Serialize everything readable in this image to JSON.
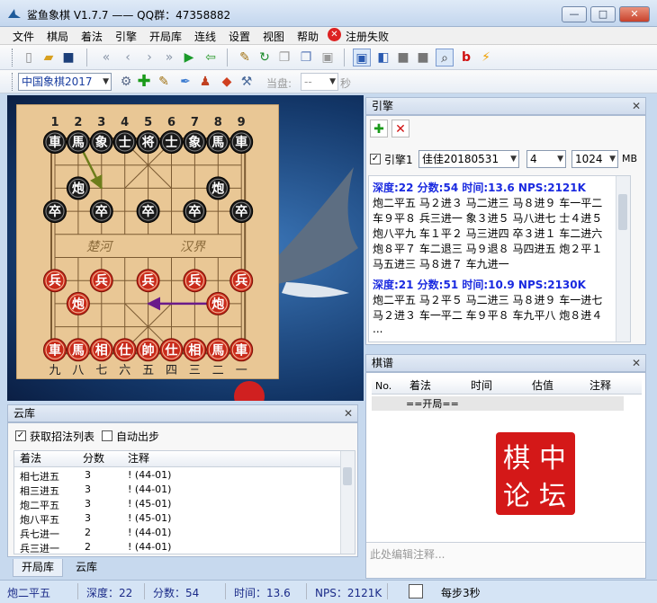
{
  "window": {
    "title": "鲨鱼象棋 V1.7.7  —— QQ群：47358882",
    "controls": {
      "minimize": "—",
      "maximize": "□",
      "close": "✕"
    }
  },
  "menu": [
    "文件",
    "棋局",
    "着法",
    "引擎",
    "开局库",
    "连线",
    "设置",
    "视图",
    "帮助"
  ],
  "menu_register": "注册失败",
  "toolbar2": {
    "engine_select": "中国象棋2017",
    "current_label": "当盘:",
    "current_value": "--",
    "seconds_label": "秒"
  },
  "board": {
    "top_numbers": [
      "1",
      "2",
      "3",
      "4",
      "5",
      "6",
      "7",
      "8",
      "9"
    ],
    "bottom_numbers": [
      "九",
      "八",
      "七",
      "六",
      "五",
      "四",
      "三",
      "二",
      "一"
    ],
    "river_left": "楚河",
    "river_right": "汉界",
    "black_pieces": [
      {
        "c": 0,
        "r": 0,
        "t": "車"
      },
      {
        "c": 1,
        "r": 0,
        "t": "馬"
      },
      {
        "c": 2,
        "r": 0,
        "t": "象"
      },
      {
        "c": 3,
        "r": 0,
        "t": "士"
      },
      {
        "c": 4,
        "r": 0,
        "t": "将"
      },
      {
        "c": 5,
        "r": 0,
        "t": "士"
      },
      {
        "c": 6,
        "r": 0,
        "t": "象"
      },
      {
        "c": 7,
        "r": 0,
        "t": "馬"
      },
      {
        "c": 8,
        "r": 0,
        "t": "車"
      },
      {
        "c": 1,
        "r": 2,
        "t": "炮"
      },
      {
        "c": 7,
        "r": 2,
        "t": "炮"
      },
      {
        "c": 0,
        "r": 3,
        "t": "卒"
      },
      {
        "c": 2,
        "r": 3,
        "t": "卒"
      },
      {
        "c": 4,
        "r": 3,
        "t": "卒"
      },
      {
        "c": 6,
        "r": 3,
        "t": "卒"
      },
      {
        "c": 8,
        "r": 3,
        "t": "卒"
      }
    ],
    "red_pieces": [
      {
        "c": 0,
        "r": 6,
        "t": "兵"
      },
      {
        "c": 2,
        "r": 6,
        "t": "兵"
      },
      {
        "c": 4,
        "r": 6,
        "t": "兵"
      },
      {
        "c": 6,
        "r": 6,
        "t": "兵"
      },
      {
        "c": 8,
        "r": 6,
        "t": "兵"
      },
      {
        "c": 1,
        "r": 7,
        "t": "炮"
      },
      {
        "c": 7,
        "r": 7,
        "t": "炮"
      },
      {
        "c": 0,
        "r": 9,
        "t": "車"
      },
      {
        "c": 1,
        "r": 9,
        "t": "馬"
      },
      {
        "c": 2,
        "r": 9,
        "t": "相"
      },
      {
        "c": 3,
        "r": 9,
        "t": "仕"
      },
      {
        "c": 4,
        "r": 9,
        "t": "帥"
      },
      {
        "c": 5,
        "r": 9,
        "t": "仕"
      },
      {
        "c": 6,
        "r": 9,
        "t": "相"
      },
      {
        "c": 7,
        "r": 9,
        "t": "馬"
      },
      {
        "c": 8,
        "r": 9,
        "t": "車"
      }
    ],
    "arrows": [
      {
        "from": [
          1,
          0
        ],
        "to": [
          2,
          2
        ],
        "color": "#6d7d1a"
      },
      {
        "from": [
          7,
          7
        ],
        "to": [
          4,
          7
        ],
        "color": "#6a1a8a"
      }
    ]
  },
  "engine_panel": {
    "title": "引擎",
    "engine_label": "引擎1",
    "engine_name": "佳佳20180531",
    "threads": "4",
    "hash": "1024",
    "hash_unit": "MB",
    "analysis": [
      {
        "header": "深度:22  分数:54  时间:13.6  NPS:2121K",
        "lines": [
          "炮二平五 马２进３ 马二进三 马８进９ 车一平二",
          "车９平８ 兵三进一 象３进５ 马八进七 士４进５",
          "炮八平九 车１平２ 马三进四 卒３进１ 车二进六",
          "炮８平７ 车二退三 马９退８ 马四进五 炮２平１",
          "马五进三 马８进７ 车九进一"
        ]
      },
      {
        "header": "深度:21  分数:51  时间:10.9  NPS:2130K",
        "lines": [
          "炮二平五 马２平５ 马二进三 马８进９ 车一进七",
          "马２进３ 车一平二 车９平８ 车九平八 炮８进４",
          "..."
        ]
      }
    ]
  },
  "qipu_panel": {
    "title": "棋谱",
    "headers": [
      "No.",
      "着法",
      "时间",
      "估值",
      "注释"
    ],
    "start_row": "==开局==",
    "stamp": [
      "中",
      "坛",
      "棋",
      "论"
    ],
    "comment_placeholder": "此处编辑注释..."
  },
  "cloud_panel": {
    "title": "云库",
    "checkbox1": "获取招法列表",
    "checkbox2": "自动出步",
    "headers": [
      "着法",
      "分数",
      "注释"
    ],
    "rows": [
      [
        "相七进五",
        "3",
        "!  (44-01)"
      ],
      [
        "相三进五",
        "3",
        "!  (44-01)"
      ],
      [
        "炮二平五",
        "3",
        "!  (45-01)"
      ],
      [
        "炮八平五",
        "3",
        "!  (45-01)"
      ],
      [
        "兵七进一",
        "2",
        "!  (44-01)"
      ],
      [
        "兵三进一",
        "2",
        "!  (44-01)"
      ]
    ],
    "tabs": [
      "开局库",
      "云库"
    ]
  },
  "status": {
    "move": "炮二平五",
    "depth": "深度：22",
    "score": "分数：54",
    "time": "时间：13.6",
    "nps": "NPS：2121K",
    "step": "每步3秒"
  }
}
